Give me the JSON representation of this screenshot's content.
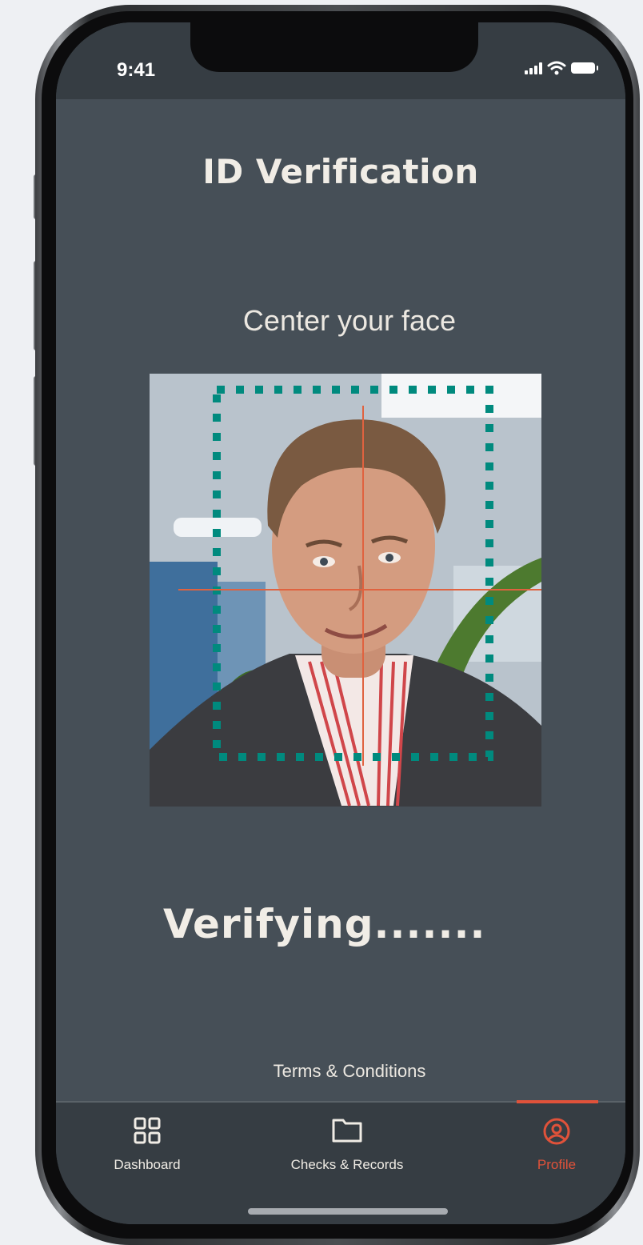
{
  "status_bar": {
    "time": "9:41",
    "icons": [
      "signal-icon",
      "wifi-icon",
      "battery-icon"
    ]
  },
  "page": {
    "title": "ID Verification",
    "instruction": "Center your face",
    "status_text": "Verifying.......",
    "terms_link": "Terms & Conditions"
  },
  "camera": {
    "frame_color": "#008a7e",
    "crosshair_color": "#e0623f"
  },
  "tabbar": {
    "items": [
      {
        "label": "Dashboard",
        "icon": "dashboard-grid-icon",
        "active": false
      },
      {
        "label": "Checks & Records",
        "icon": "folder-icon",
        "active": false
      },
      {
        "label": "Profile",
        "icon": "profile-icon",
        "active": true
      }
    ],
    "active_color": "#e0523a"
  },
  "colors": {
    "screen_bg": "#464f57",
    "bar_bg": "#363d43",
    "text": "#f1ede6"
  }
}
